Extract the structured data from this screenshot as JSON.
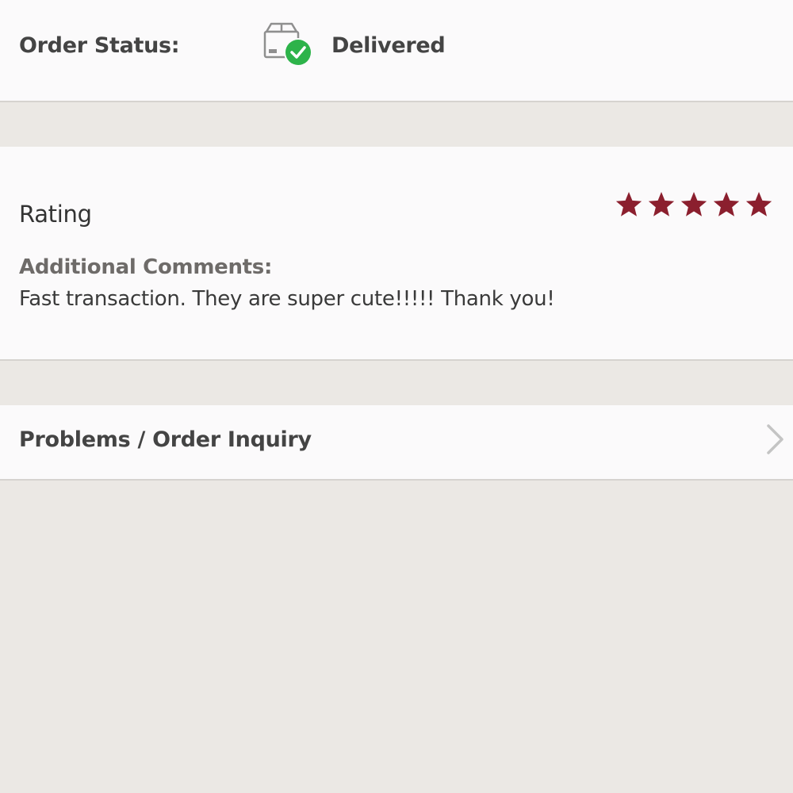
{
  "order_status": {
    "label": "Order Status:",
    "value": "Delivered",
    "icon": "box-delivered-icon",
    "check_color": "#2db34a"
  },
  "rating": {
    "label": "Rating",
    "stars": 5,
    "max_stars": 5,
    "star_color": "#8b1f2e"
  },
  "comments": {
    "label": "Additional Comments:",
    "text": "Fast transaction. They are super cute!!!!! Thank you!"
  },
  "inquiry": {
    "label": "Problems / Order Inquiry",
    "icon": "chevron-right-icon"
  }
}
